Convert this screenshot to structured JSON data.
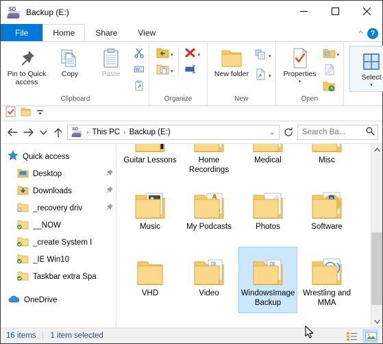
{
  "window": {
    "title": "Backup (E:)",
    "drive_icon": "sd-card-drive-icon",
    "minimize_label": "Minimize",
    "maximize_label": "Maximize",
    "close_label": "Close",
    "collapse_ribbon_label": "^",
    "help_label": "?"
  },
  "tabs": [
    {
      "label": "File",
      "name": "tab-file"
    },
    {
      "label": "Home",
      "name": "tab-home"
    },
    {
      "label": "Share",
      "name": "tab-share"
    },
    {
      "label": "View",
      "name": "tab-view"
    }
  ],
  "ribbon": {
    "groups": [
      {
        "name": "clipboard",
        "label": "Clipboard",
        "big_buttons": [
          {
            "label": "Pin to Quick access",
            "icon": "pin-icon",
            "disabled": false
          },
          {
            "label": "Copy",
            "icon": "copy-icon",
            "disabled": false
          },
          {
            "label": "Paste",
            "icon": "paste-icon",
            "disabled": true
          }
        ],
        "small_buttons": [
          {
            "label": "Cut",
            "icon": "scissors-icon"
          },
          {
            "label": "Copy path",
            "icon": "copy-path-icon"
          },
          {
            "label": "Paste shortcut",
            "icon": "paste-shortcut-icon"
          }
        ]
      },
      {
        "name": "organize",
        "label": "Organize",
        "small_buttons": [
          {
            "label": "Move to",
            "icon": "move-to-icon"
          },
          {
            "label": "Delete",
            "icon": "delete-x-icon"
          },
          {
            "label": "Copy to",
            "icon": "copy-to-icon"
          },
          {
            "label": "Rename",
            "icon": "rename-icon"
          }
        ]
      },
      {
        "name": "new",
        "label": "New",
        "big_buttons": [
          {
            "label": "New folder",
            "icon": "new-folder-icon",
            "disabled": false
          }
        ],
        "small_buttons": [
          {
            "label": "New item",
            "icon": "new-item-icon"
          },
          {
            "label": "Easy access",
            "icon": "easy-access-icon"
          }
        ]
      },
      {
        "name": "open",
        "label": "Open",
        "big_buttons": [
          {
            "label": "Properties",
            "icon": "properties-icon",
            "disabled": false
          }
        ],
        "small_buttons": [
          {
            "label": "Open",
            "icon": "open-folder-icon"
          },
          {
            "label": "Edit",
            "icon": "edit-icon"
          },
          {
            "label": "History",
            "icon": "history-icon"
          }
        ]
      },
      {
        "name": "select",
        "label": "",
        "big_buttons": [
          {
            "label": "Select",
            "icon": "select-icon",
            "disabled": false
          }
        ]
      }
    ]
  },
  "qat": {
    "buttons": [
      {
        "label": "Properties",
        "icon": "properties-check-icon"
      },
      {
        "label": "New folder",
        "icon": "folder-icon"
      },
      {
        "label": "Customize Quick Access Toolbar",
        "icon": "chevron-down-icon"
      }
    ]
  },
  "address": {
    "back_icon": "arrow-left-icon",
    "forward_icon": "arrow-right-icon",
    "recent_icon": "chevron-down-icon",
    "up_icon": "arrow-up-icon",
    "crumbs": [
      "This PC",
      "Backup (E:)"
    ],
    "dropdown_icon": "chevron-down-icon",
    "refresh_icon": "refresh-icon",
    "search_placeholder": "Search Ba...",
    "search_icon": "search-icon"
  },
  "navpane": {
    "items": [
      {
        "label": "Quick access",
        "icon": "quick-access-star-icon",
        "level": 0,
        "pinned": false,
        "badge": ""
      },
      {
        "label": "Desktop",
        "icon": "desktop-folder-icon",
        "level": 1,
        "pinned": true,
        "badge": ""
      },
      {
        "label": "Downloads",
        "icon": "downloads-folder-icon",
        "level": 1,
        "pinned": true,
        "badge": ""
      },
      {
        "label": "_recovery driv",
        "icon": "folder-icon",
        "level": 1,
        "pinned": true,
        "badge": "sync-pending"
      },
      {
        "label": "__NOW",
        "icon": "folder-icon",
        "level": 1,
        "pinned": false,
        "badge": "sync-ok"
      },
      {
        "label": "_create System I",
        "icon": "folder-icon",
        "level": 1,
        "pinned": false,
        "badge": "sync-ok"
      },
      {
        "label": "_IE Win10",
        "icon": "folder-icon",
        "level": 1,
        "pinned": false,
        "badge": "sync-ok"
      },
      {
        "label": "Taskbar extra Spa",
        "icon": "folder-icon",
        "level": 1,
        "pinned": false,
        "badge": "sync-ok"
      },
      {
        "label": "OneDrive",
        "icon": "onedrive-cloud-icon",
        "level": 0,
        "pinned": false,
        "badge": ""
      }
    ]
  },
  "files": {
    "items": [
      {
        "label": "Guitar Lessons",
        "thumb": "guitar-thumb"
      },
      {
        "label": "Home Recordings",
        "thumb": "audio-disc-thumb"
      },
      {
        "label": "Medical",
        "thumb": "document-thumb"
      },
      {
        "label": "Misc",
        "thumb": "document-thumb"
      },
      {
        "label": "Music",
        "thumb": "photo-thumb"
      },
      {
        "label": "My Podcasts",
        "thumb": "vlc-cone-thumb"
      },
      {
        "label": "Photos",
        "thumb": "mortar-pestle-thumb"
      },
      {
        "label": "Software",
        "thumb": "badge-thumb"
      },
      {
        "label": "VHD",
        "thumb": ""
      },
      {
        "label": "Video",
        "thumb": "film-thumb"
      },
      {
        "label": "WindowsImageBackup",
        "thumb": "film-thumb",
        "selected": true
      },
      {
        "label": "Wrestling and MMA",
        "thumb": "disc-thumb"
      }
    ]
  },
  "statusbar": {
    "item_count": "16 items",
    "selection": "1 item selected",
    "views": [
      {
        "label": "Details view",
        "icon": "details-view-icon",
        "active": false
      },
      {
        "label": "Large icons view",
        "icon": "large-icons-view-icon",
        "active": true
      }
    ]
  },
  "scrollbar": {
    "up_icon": "chevron-up-icon",
    "down_icon": "chevron-down-icon"
  },
  "colors": {
    "accent": "#0078d7",
    "selection": "#cce8ff",
    "folder": "#fcd88a",
    "status_text": "#1a4f8a"
  }
}
